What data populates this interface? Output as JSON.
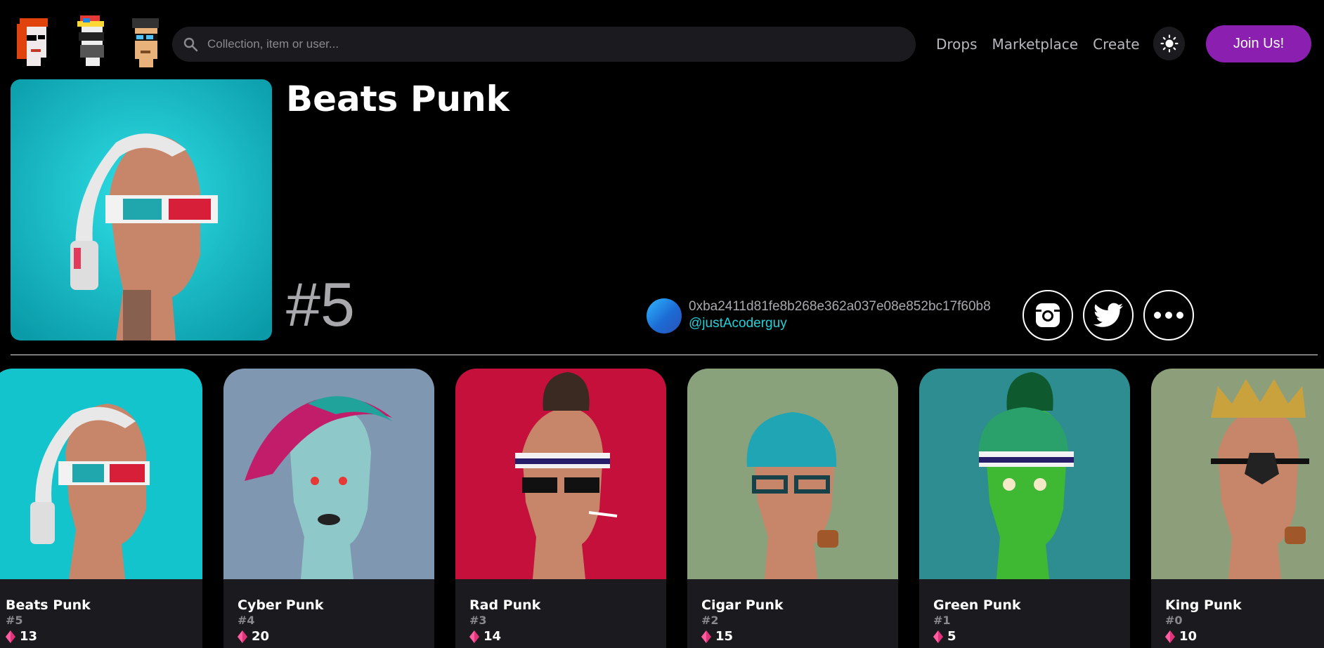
{
  "header": {
    "search_placeholder": "Collection, item or user...",
    "nav": [
      "Drops",
      "Marketplace",
      "Create"
    ],
    "join_label": "Join Us!"
  },
  "item": {
    "title": "Beats Punk",
    "number": "#5",
    "owner_address": "0xba2411d81fe8b268e362a037e08e852bc17f60b8",
    "owner_handle": "@justAcoderguy"
  },
  "cards": [
    {
      "name": "Beats Punk",
      "number": "#5",
      "price": "13",
      "bg": "#14c4cc"
    },
    {
      "name": "Cyber Punk",
      "number": "#4",
      "price": "20",
      "bg": "#7f97b0"
    },
    {
      "name": "Rad Punk",
      "number": "#3",
      "price": "14",
      "bg": "#c4103a"
    },
    {
      "name": "Cigar Punk",
      "number": "#2",
      "price": "15",
      "bg": "#8aa27c"
    },
    {
      "name": "Green Punk",
      "number": "#1",
      "price": "5",
      "bg": "#2e8d90"
    },
    {
      "name": "King Punk",
      "number": "#0",
      "price": "10",
      "bg": "#8d9f7a"
    }
  ],
  "colors": {
    "accent": "#8a1fb0",
    "handle": "#21d1d8",
    "panel": "#1b1b1f"
  }
}
